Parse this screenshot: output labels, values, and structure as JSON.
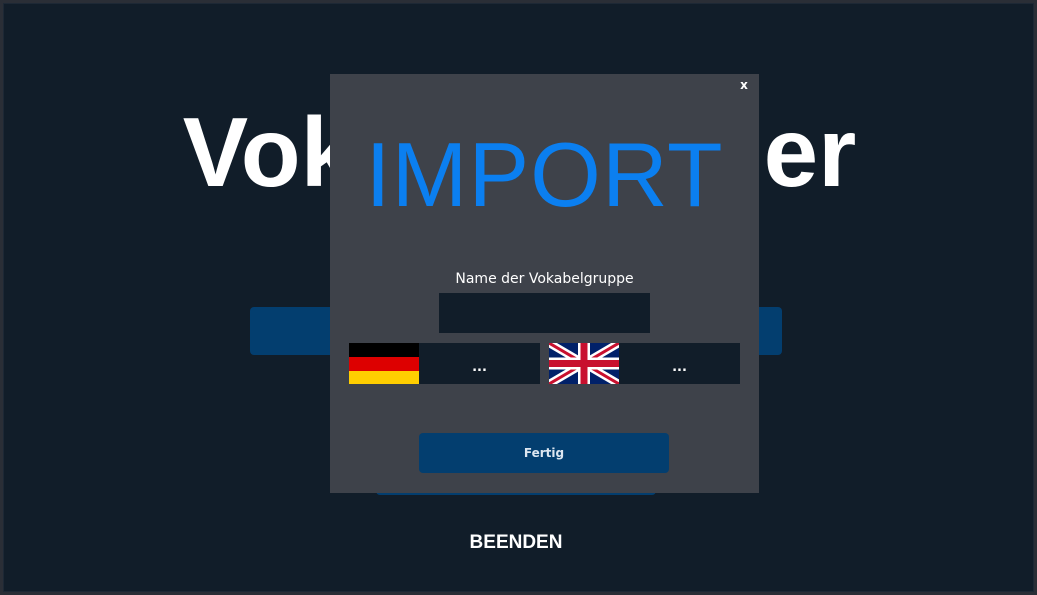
{
  "main": {
    "title": "Vokabeltrainer",
    "quit_label": "BEENDEN"
  },
  "dialog": {
    "close_label": "x",
    "title": "IMPORT",
    "group_name_label": "Name der Vokabelgruppe",
    "group_name_value": "",
    "source_language": {
      "flag": "germany-flag-icon",
      "picker_label": "..."
    },
    "target_language": {
      "flag": "united-kingdom-flag-icon",
      "picker_label": "..."
    },
    "done_label": "Fertig"
  },
  "colors": {
    "window_bg": "#111d29",
    "dialog_bg": "#3e424a",
    "accent_blue": "#0b7ff0",
    "button_blue": "#033e6f",
    "text": "#ffffff"
  }
}
